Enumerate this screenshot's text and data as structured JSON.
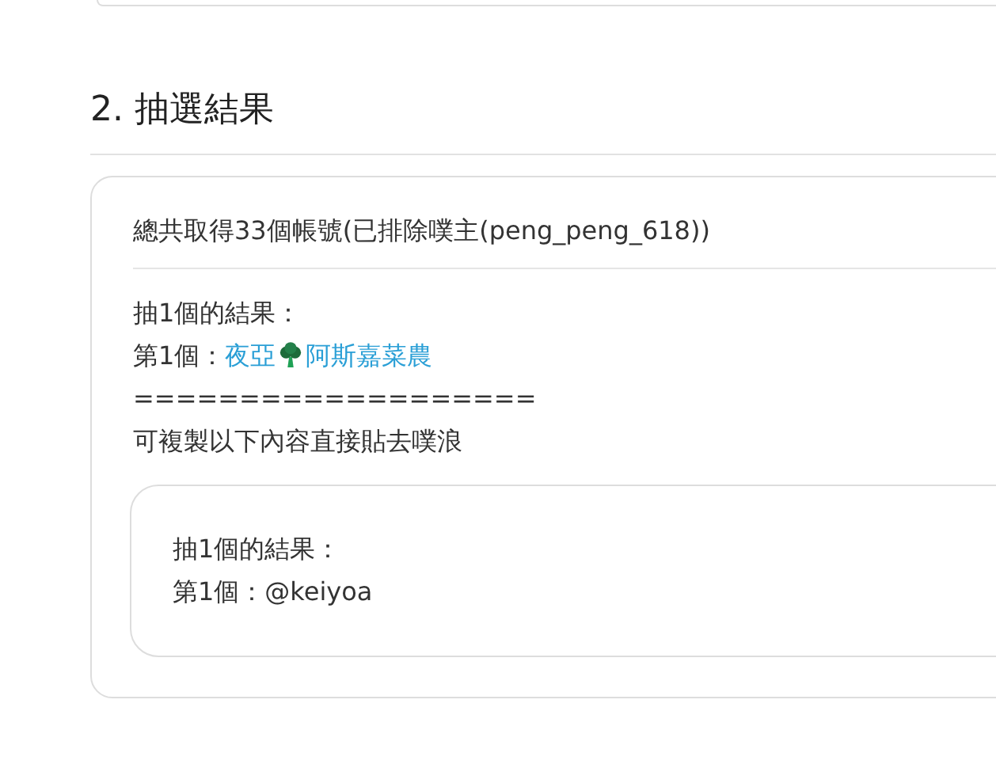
{
  "section": {
    "number": "2.",
    "title": "抽選結果"
  },
  "result": {
    "summary": "總共取得33個帳號(已排除噗主(peng_peng_618))",
    "draw_title": "抽1個的結果：",
    "winners": [
      {
        "prefix": "第1個：",
        "name_start": "夜亞",
        "name_end": "阿斯嘉菜農"
      }
    ],
    "separator": "===================",
    "copy_hint": "可複製以下內容直接貼去噗浪",
    "copy_lines": [
      "抽1個的結果：",
      "第1個：@keiyoa"
    ]
  }
}
